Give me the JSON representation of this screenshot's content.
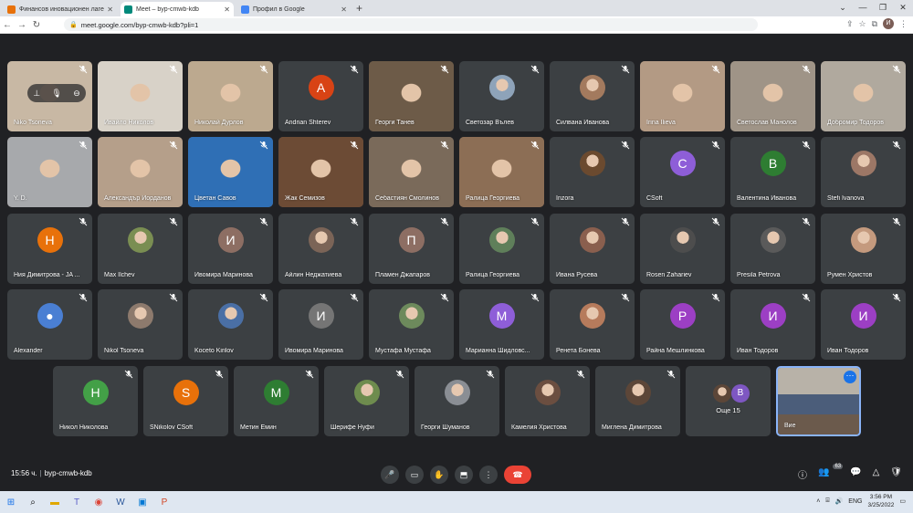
{
  "browser": {
    "tabs": [
      {
        "title": "Финансов иновационен лагер :",
        "icon_color": "#e8710a",
        "active": false
      },
      {
        "title": "Meet – byp-cmwb-kdb",
        "icon_color": "#00897b",
        "active": true
      },
      {
        "title": "Профил в Google",
        "icon_color": "#4285f4",
        "active": false
      }
    ],
    "new_tab": "+",
    "url": "meet.google.com/byp-cmwb-kdb?pli=1",
    "profile_initial": "И"
  },
  "tiles": [
    {
      "name": "Niko Tsoneva",
      "type": "video",
      "color": "#c8b8a4"
    },
    {
      "name": "Ивайло Николов",
      "type": "video",
      "color": "#d8d2c8"
    },
    {
      "name": "Николай Дурлов",
      "type": "video",
      "color": "#bca98f"
    },
    {
      "name": "Andrian Shterev",
      "type": "avatar",
      "letter": "A",
      "color": "#d84315"
    },
    {
      "name": "Георги Танев",
      "type": "video",
      "color": "#6d5b48"
    },
    {
      "name": "Светозар Вълев",
      "type": "photo",
      "color": "#8ea3b9"
    },
    {
      "name": "Силвана Иванова",
      "type": "photo",
      "color": "#a37a5e"
    },
    {
      "name": "Irina Ilieva",
      "type": "video",
      "color": "#b39a84"
    },
    {
      "name": "Светослав Манолов",
      "type": "video",
      "color": "#9f9487"
    },
    {
      "name": "Добромир Тодоров",
      "type": "video",
      "color": "#b0a99e"
    },
    {
      "name": "Y. D.",
      "type": "video",
      "color": "#a7a9ac"
    },
    {
      "name": "Александър Йорданов",
      "type": "video",
      "color": "#b59f8a"
    },
    {
      "name": "Цветан Савов",
      "type": "video",
      "color": "#2f6fb5"
    },
    {
      "name": "Жак Семизов",
      "type": "video",
      "color": "#6c4b35"
    },
    {
      "name": "Себастиян Смолинов",
      "type": "video",
      "color": "#7a6a5a"
    },
    {
      "name": "Ралица Георгиева",
      "type": "video",
      "color": "#8c6e55"
    },
    {
      "name": "Inzora",
      "type": "photo",
      "color": "#6b4a2f"
    },
    {
      "name": "CSoft",
      "type": "avatar",
      "letter": "C",
      "color": "#8e5ed8"
    },
    {
      "name": "Валентина Иванова",
      "type": "avatar",
      "letter": "В",
      "color": "#2e7d32"
    },
    {
      "name": "Stefi Ivanova",
      "type": "photo",
      "color": "#9c7766"
    },
    {
      "name": "Ния Димитрова - JA ...",
      "type": "avatar",
      "letter": "Н",
      "color": "#e8710a"
    },
    {
      "name": "Max Ilchev",
      "type": "photo",
      "color": "#7a8e52"
    },
    {
      "name": "Ивомира Маринова",
      "type": "avatar",
      "letter": "И",
      "color": "#8d6e63"
    },
    {
      "name": "Айлин Неджатиева",
      "type": "photo",
      "color": "#7b6457"
    },
    {
      "name": "Пламен Джапаров",
      "type": "avatar",
      "letter": "П",
      "color": "#8d6e63"
    },
    {
      "name": "Ралица Георгиева",
      "type": "photo",
      "color": "#5f7f5a"
    },
    {
      "name": "Ивана Русева",
      "type": "photo",
      "color": "#8a5f4e"
    },
    {
      "name": "Rosen Zahariev",
      "type": "photo",
      "color": "#4d4d4d"
    },
    {
      "name": "Presila Petrova",
      "type": "photo",
      "color": "#5a5a5a"
    },
    {
      "name": "Румен Христов",
      "type": "photo",
      "color": "#c49a7e"
    },
    {
      "name": "Alexander",
      "type": "avatar",
      "letter": "●",
      "color": "#4a7fd3"
    },
    {
      "name": "Nikol Tsoneva",
      "type": "photo",
      "color": "#8d7a6d"
    },
    {
      "name": "Koceto Kirilov",
      "type": "photo",
      "color": "#4a6fa5"
    },
    {
      "name": "Ивомира Маринова",
      "type": "avatar",
      "letter": "И",
      "color": "#757575"
    },
    {
      "name": "Мустафа Мустафа",
      "type": "photo",
      "color": "#6d8a5c"
    },
    {
      "name": "Марианна Шидловс...",
      "type": "avatar",
      "letter": "М",
      "color": "#8e5ed8"
    },
    {
      "name": "Ренета Бонева",
      "type": "photo",
      "color": "#b67b5c"
    },
    {
      "name": "Райна Мешлинкова",
      "type": "avatar",
      "letter": "Р",
      "color": "#9c3fc4"
    },
    {
      "name": "Иван Тодоров",
      "type": "avatar",
      "letter": "И",
      "color": "#9c3fc4"
    },
    {
      "name": "Иван Тодоров",
      "type": "avatar",
      "letter": "И",
      "color": "#9c3fc4"
    }
  ],
  "bottom_row": [
    {
      "name": "Никол Николова",
      "type": "avatar",
      "letter": "Н",
      "color": "#43a047"
    },
    {
      "name": "SNikolov CSoft",
      "type": "avatar",
      "letter": "S",
      "color": "#e8710a"
    },
    {
      "name": "Метин Емин",
      "type": "avatar",
      "letter": "М",
      "color": "#2e7d32"
    },
    {
      "name": "Шерифе Нуфи",
      "type": "photo",
      "color": "#6e8c4e"
    },
    {
      "name": "Георги Шуманов",
      "type": "photo",
      "color": "#8a8e94"
    },
    {
      "name": "Камелия Христова",
      "type": "photo",
      "color": "#6b4e40"
    },
    {
      "name": "Миглена Димитрова",
      "type": "photo",
      "color": "#5c4638"
    }
  ],
  "more_tile": {
    "label": "Още 15",
    "avatar_letter": "В",
    "avatar_color": "#7e57c2"
  },
  "self_tile": {
    "name": "Вие",
    "more_icon": "⋯"
  },
  "meeting": {
    "time": "15:56 ч.",
    "separator": "|",
    "code": "byp-cmwb-kdb",
    "participants": "63"
  },
  "taskbar": {
    "time": "3:56 PM",
    "date": "3/25/2022",
    "lang": "ENG"
  }
}
